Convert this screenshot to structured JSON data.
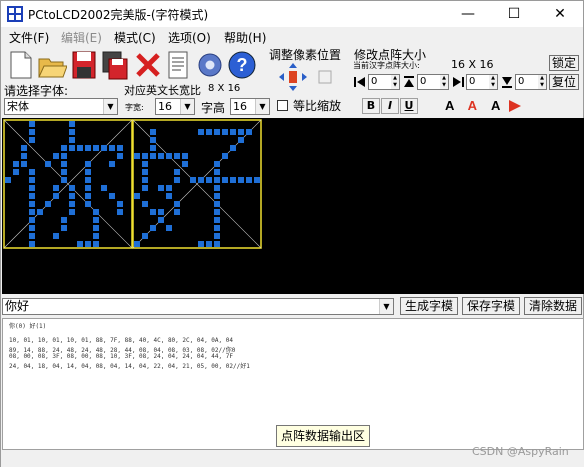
{
  "window": {
    "title": "PCtoLCD2002完美版-(字符模式)",
    "controls": {
      "minimize": "—",
      "maximize": "☐",
      "close": "✕"
    }
  },
  "menu": [
    "文件(F)",
    "编辑(E)",
    "模式(C)",
    "选项(O)",
    "帮助(H)"
  ],
  "toolbar": {
    "pixel_position_label": "调整像素位置",
    "dot_size_label": "修改点阵大小",
    "current_dot_size_label": "当前汉字点阵大小:",
    "current_dot_size_value": "16 X 16",
    "lock_button": "锁定",
    "restore_button": "复位",
    "spin_values": [
      "0",
      "0",
      "0",
      "0"
    ],
    "font_select_label": "请选择字体:",
    "font_value": "宋体",
    "en_width_label": "对应英文长宽比",
    "en_width_value": "8 X 16",
    "char_width_label": "字宽:",
    "char_width_value": "16",
    "char_height_label": "字高",
    "char_height_value": "16",
    "proportional_label": "等比缩放",
    "bold_btn": "B",
    "italic_btn": "I",
    "underline_btn": "U"
  },
  "editor": {
    "input_text": "你好",
    "generate_button": "生成字模",
    "save_button": "保存字模",
    "clear_button": "清除数据"
  },
  "output": {
    "lines": [
      "你(0) 好(1)",
      "",
      "10, 01, 10, 01, 10, 01, 88, 7F, 88, 40, 4C, 80, 2C, 04, 0A, 04",
      "89, 14, 88, 24, 48, 24, 48, 28, 44, 08, 04, 08, 03, 08, 02//你0",
      "08, 00, 08, 3F, 08, 00, 08, 10, 3F, 08, 24, 04, 24, 04, 44, 7F",
      "24, 04, 18, 04, 14, 04, 08, 04, 14, 04, 22, 04, 21, 05, 00, 02//好1"
    ],
    "tooltip": "点阵数据输出区"
  },
  "watermark": "CSDN @AspyRain",
  "colors": {
    "pixel_on": "#1f6fd6",
    "grid_border": "#f0e030",
    "canvas_bg": "#000000"
  },
  "glyphs": {
    "ni": [
      "0001000010000000",
      "0001000010000000",
      "0001000010000000",
      "0010000111111110",
      "0010001100000010",
      "0110010100100100",
      "0101000100100000",
      "1001000100100000",
      "0001001010101000",
      "0001001010100100",
      "0001010010100010",
      "0001100010010010",
      "0001000100010000",
      "0001000100010000",
      "0001001000010000",
      "0001000001110000"
    ],
    "hao": [
      "0000000000000000",
      "0010000011111110",
      "0010000000000100",
      "0010000000001000",
      "1111111000010000",
      "0100001000100000",
      "0100010000100000",
      "0100010111111111",
      "0101100000100000",
      "1000100000100000",
      "0100010000100000",
      "0011010000100000",
      "0001000000100000",
      "0010100000100000",
      "0100000000100000",
      "1000000011100000"
    ]
  }
}
